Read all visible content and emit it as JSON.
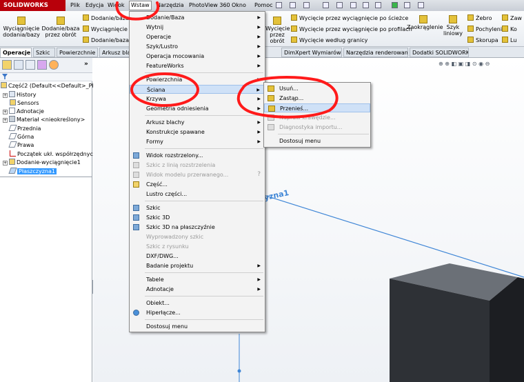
{
  "app": {
    "logo_text": "SOLIDWORKS",
    "brand_color": "#b8000a"
  },
  "menubar": {
    "items": [
      "Plik",
      "Edycja",
      "Widok",
      "Wstaw",
      "Narzędzia",
      "PhotoView 360",
      "Okno",
      "Pomoc"
    ],
    "active": "Wstaw"
  },
  "ribbon": {
    "big1": "Wyciągnięcie dodania/bazy",
    "big2": "Dodanie/baza przez obrót",
    "small_col1": [
      "Dodanie/baza",
      "Wyciągnięcie p",
      "Dodanie/baza w"
    ],
    "big3": "Wycięcie przez obrót",
    "small_col2": [
      "Wycięcie przez wyciągnięcie po ścieżce",
      "Wycięcie przez wyciągnięcie po profilach",
      "Wycięcie według granicy"
    ],
    "fillet": "Zaokrąglenie",
    "pattern": "Szyk liniowy",
    "small_col3": [
      "Żebro",
      "Pochylenie",
      "Skorupa"
    ],
    "small_col4": [
      "Zaw",
      "Ko",
      "Lu"
    ]
  },
  "cmtabs": [
    "Operacje",
    "Szkic",
    "Powierzchnie",
    "Arkusz blach",
    "DimXpert Wymiarów",
    "Narzędzia renderowania",
    "Dodatki SOLIDWORKS"
  ],
  "tree": {
    "root": "Część2  (Default<<Default>_Pho",
    "items": [
      "History",
      "Sensors",
      "Adnotacje",
      "Materiał <nieokreślony>",
      "Przednia",
      "Górna",
      "Prawa",
      "Początek ukł. współrzędnych",
      "Dodanie-wyciągnięcie1",
      "Płaszczyzna1"
    ]
  },
  "insert_menu": [
    {
      "label": "Dodanie/Baza",
      "sub": true
    },
    {
      "label": "Wytnij",
      "sub": true
    },
    {
      "label": "Operacje",
      "sub": true
    },
    {
      "label": "Szyk/Lustro",
      "sub": true
    },
    {
      "label": "Operacja mocowania",
      "sub": true
    },
    {
      "label": "FeatureWorks",
      "sub": true
    },
    {
      "label": "Powierzchnia",
      "sub": true
    },
    {
      "label": "Ściana",
      "sub": true
    },
    {
      "label": "Krzywa",
      "sub": true
    },
    {
      "label": "Geometria odniesienia",
      "sub": true
    },
    {
      "label": "Arkusz blachy",
      "sub": true
    },
    {
      "label": "Konstrukcje spawane",
      "sub": true
    },
    {
      "label": "Formy",
      "sub": true
    },
    {
      "label": "Widok rozstrzelony..."
    },
    {
      "label": "Szkic z linią rozstrzelenia"
    },
    {
      "label": "Widok modelu przerwanego..."
    },
    {
      "label": "Część..."
    },
    {
      "label": "Lustro części..."
    },
    {
      "label": "Szkic"
    },
    {
      "label": "Szkic 3D"
    },
    {
      "label": "Szkic 3D na płaszczyźnie"
    },
    {
      "label": "Wyprowadzony szkic"
    },
    {
      "label": "Szkic z rysunku"
    },
    {
      "label": "DXF/DWG..."
    },
    {
      "label": "Badanie projektu",
      "sub": true
    },
    {
      "label": "Tabele",
      "sub": true
    },
    {
      "label": "Adnotacje",
      "sub": true
    },
    {
      "label": "Obiekt..."
    },
    {
      "label": "Hiperłącze..."
    },
    {
      "label": "Dostosuj menu"
    }
  ],
  "face_submenu": [
    "Usuń...",
    "Zastąp...",
    "Przenieś...",
    "Napraw krawędzie...",
    "Diagnostyka importu...",
    "Dostosuj menu"
  ],
  "viewport": {
    "plane_label": "czyzna1"
  },
  "colors": {
    "selection": "#3399ff",
    "annotation_red": "#ff1a1a",
    "plane_line": "#3f86d6",
    "box_front": "#2e3136",
    "box_top": "#6b7077",
    "box_side": "#1c1e22"
  }
}
